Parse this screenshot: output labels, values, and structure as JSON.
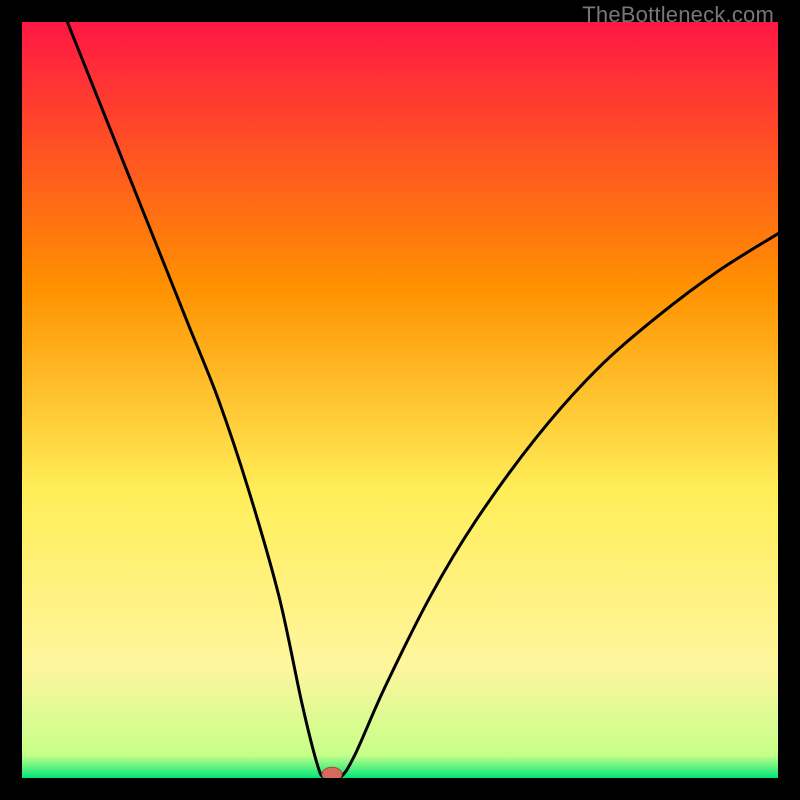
{
  "watermark": "TheBottleneck.com",
  "chart_data": {
    "type": "line",
    "title": "",
    "xlabel": "",
    "ylabel": "",
    "xlim": [
      0,
      100
    ],
    "ylim": [
      0,
      100
    ],
    "grid": false,
    "legend": false,
    "gradient_colors": {
      "top": "#ff1744",
      "upper_mid": "#ff9100",
      "mid": "#ffee58",
      "lower_mid": "#fff59d",
      "bottom": "#00e676"
    },
    "curve": {
      "description": "V-shaped bottleneck curve with minimum near x≈40 touching y≈0; left branch starts at (x=6,y=100); right branch ends at (x=100,y≈72)",
      "points": [
        {
          "x": 6,
          "y": 100
        },
        {
          "x": 10,
          "y": 90
        },
        {
          "x": 14,
          "y": 80
        },
        {
          "x": 18,
          "y": 70
        },
        {
          "x": 22,
          "y": 60
        },
        {
          "x": 26,
          "y": 50
        },
        {
          "x": 30,
          "y": 38
        },
        {
          "x": 34,
          "y": 24
        },
        {
          "x": 37,
          "y": 10
        },
        {
          "x": 39,
          "y": 2
        },
        {
          "x": 40,
          "y": 0
        },
        {
          "x": 42,
          "y": 0
        },
        {
          "x": 44,
          "y": 3
        },
        {
          "x": 48,
          "y": 12
        },
        {
          "x": 54,
          "y": 24
        },
        {
          "x": 60,
          "y": 34
        },
        {
          "x": 68,
          "y": 45
        },
        {
          "x": 76,
          "y": 54
        },
        {
          "x": 84,
          "y": 61
        },
        {
          "x": 92,
          "y": 67
        },
        {
          "x": 100,
          "y": 72
        }
      ]
    },
    "marker": {
      "description": "optimal point marker at curve minimum",
      "x": 41,
      "y": 0.5,
      "color": "#d66a5e"
    }
  }
}
